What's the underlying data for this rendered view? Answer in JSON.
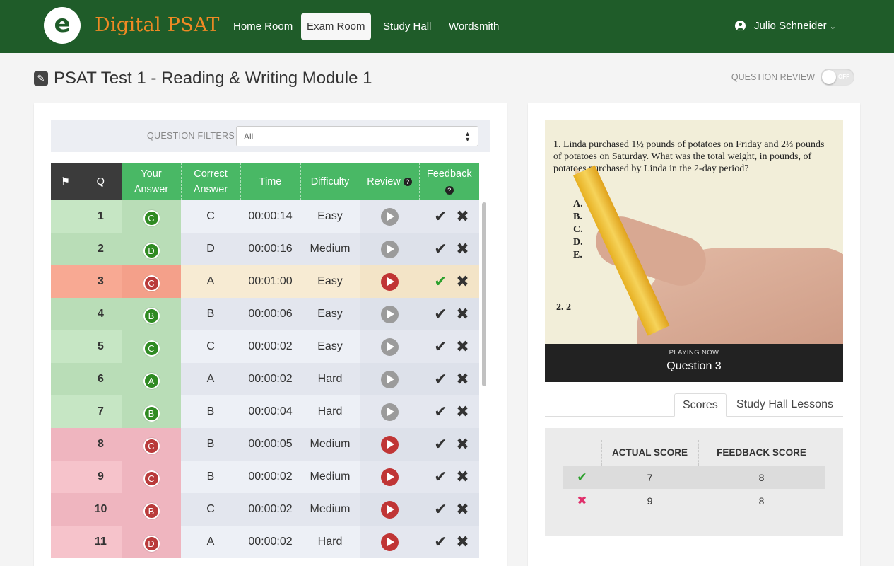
{
  "app": {
    "logo_letter": "e",
    "brand": "Digital PSAT"
  },
  "nav": {
    "items": [
      {
        "label": "Home Room",
        "active": false
      },
      {
        "label": "Exam Room",
        "active": true
      },
      {
        "label": "Study Hall",
        "active": false
      },
      {
        "label": "Wordsmith",
        "active": false
      }
    ],
    "user_name": "Julio Schneider",
    "user_caret": "⌄"
  },
  "page": {
    "title": "PSAT Test 1 - Reading & Writing Module 1",
    "question_review_label": "QUESTION REVIEW",
    "toggle_text": "OFF"
  },
  "filters": {
    "label": "QUESTION FILTERS",
    "selected": "All"
  },
  "table": {
    "headers": {
      "flag": "⚑",
      "q": "Q",
      "your_answer": [
        "Your",
        "Answer"
      ],
      "correct_answer": [
        "Correct",
        "Answer"
      ],
      "time": "Time",
      "difficulty": "Difficulty",
      "review": "Review",
      "feedback": "Feedback"
    },
    "rows": [
      {
        "q": "1",
        "your": "C",
        "correct": "C",
        "time": "00:00:14",
        "difficulty": "Easy",
        "result": "correct",
        "review": "grey",
        "feedback_check_on": false
      },
      {
        "q": "2",
        "your": "D",
        "correct": "D",
        "time": "00:00:16",
        "difficulty": "Medium",
        "result": "correct",
        "review": "grey",
        "feedback_check_on": false
      },
      {
        "q": "3",
        "your": "C",
        "correct": "A",
        "time": "00:01:00",
        "difficulty": "Easy",
        "result": "current",
        "review": "red",
        "feedback_check_on": true
      },
      {
        "q": "4",
        "your": "B",
        "correct": "B",
        "time": "00:00:06",
        "difficulty": "Easy",
        "result": "correct",
        "review": "grey",
        "feedback_check_on": false
      },
      {
        "q": "5",
        "your": "C",
        "correct": "C",
        "time": "00:00:02",
        "difficulty": "Easy",
        "result": "correct",
        "review": "grey",
        "feedback_check_on": false
      },
      {
        "q": "6",
        "your": "A",
        "correct": "A",
        "time": "00:00:02",
        "difficulty": "Hard",
        "result": "correct",
        "review": "grey",
        "feedback_check_on": false
      },
      {
        "q": "7",
        "your": "B",
        "correct": "B",
        "time": "00:00:04",
        "difficulty": "Hard",
        "result": "correct",
        "review": "grey",
        "feedback_check_on": false
      },
      {
        "q": "8",
        "your": "C",
        "correct": "B",
        "time": "00:00:05",
        "difficulty": "Medium",
        "result": "wrong",
        "review": "red",
        "feedback_check_on": false
      },
      {
        "q": "9",
        "your": "C",
        "correct": "B",
        "time": "00:00:02",
        "difficulty": "Medium",
        "result": "wrong",
        "review": "red",
        "feedback_check_on": false
      },
      {
        "q": "10",
        "your": "B",
        "correct": "C",
        "time": "00:00:02",
        "difficulty": "Medium",
        "result": "wrong",
        "review": "red",
        "feedback_check_on": false
      },
      {
        "q": "11",
        "your": "D",
        "correct": "A",
        "time": "00:00:02",
        "difficulty": "Hard",
        "result": "wrong",
        "review": "red",
        "feedback_check_on": false
      }
    ]
  },
  "video": {
    "question_text": "1.  Linda purchased 1½ pounds of potatoes on Friday and 2⅓ pounds of potatoes on Saturday. What was the total weight, in pounds, of potatoes purchased by Linda in the 2-day period?",
    "choices": [
      "A.",
      "B.",
      "C.",
      "D.",
      "E."
    ],
    "next_question": "2.  2",
    "playing_now_label": "PLAYING NOW",
    "playing_title": "Question 3"
  },
  "tabs": [
    {
      "label": "Scores",
      "active": true
    },
    {
      "label": "Study Hall Lessons",
      "active": false
    }
  ],
  "scores": {
    "headers": [
      "ACTUAL SCORE",
      "FEEDBACK SCORE"
    ],
    "rows": [
      {
        "icon": "check",
        "actual": "7",
        "feedback": "8"
      },
      {
        "icon": "cross",
        "actual": "9",
        "feedback": "8"
      }
    ]
  },
  "colors": {
    "nav_bg": "#1f5c29",
    "brand": "#f08a24",
    "header_green": "#49b865",
    "correct_row": "#c6e6c4",
    "wrong_row": "#f6c3cb",
    "current_row": "#f8a993"
  }
}
